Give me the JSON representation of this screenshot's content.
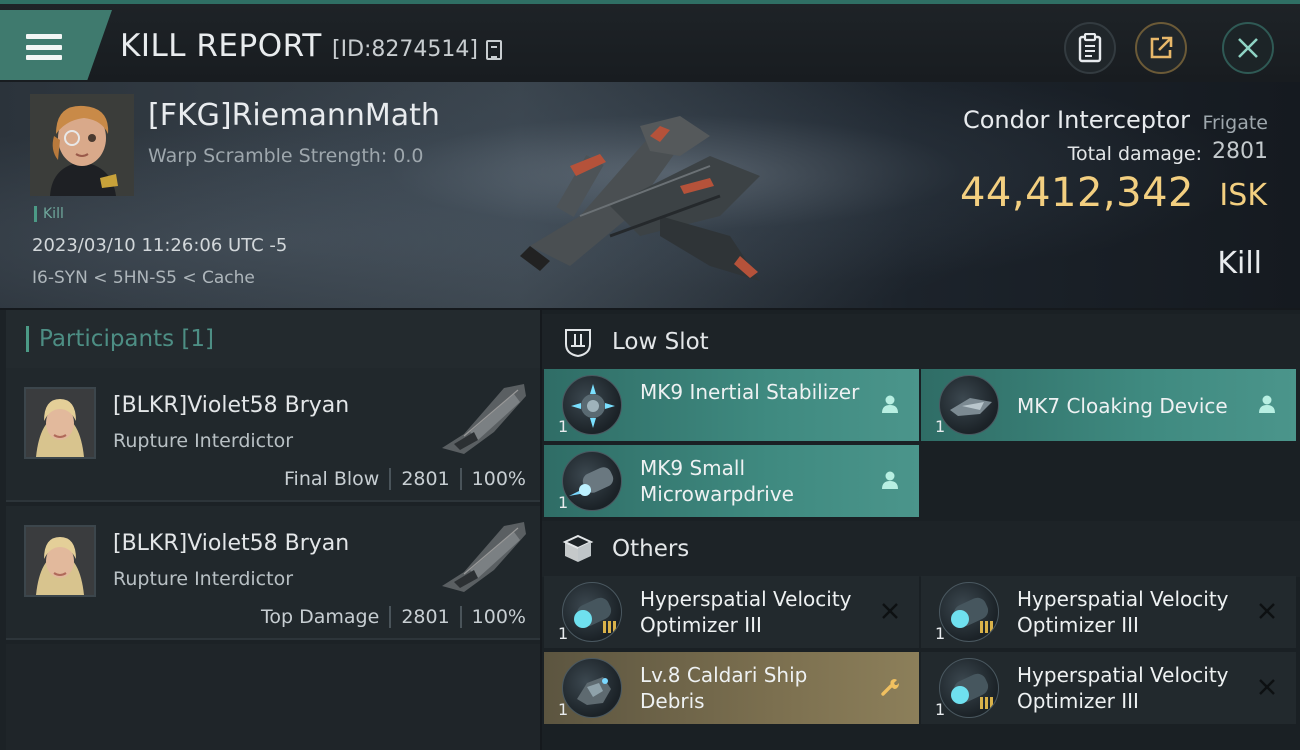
{
  "header": {
    "title": "KILL REPORT",
    "report_id": "[ID:8274514]"
  },
  "victim": {
    "pilot_name": "[FKG]RiemannMath",
    "warp_scramble": "Warp Scramble Strength: 0.0",
    "kill_tag": "Kill",
    "timestamp": "2023/03/10 11:26:06 UTC -5",
    "location": "I6-SYN < 5HN-S5 < Cache",
    "ship_name": "Condor Interceptor",
    "ship_class": "Frigate",
    "total_damage_label": "Total damage:",
    "total_damage": "2801",
    "isk_value": "44,412,342",
    "isk_unit": "ISK",
    "result": "Kill"
  },
  "participants": {
    "title": "Participants",
    "count": "[1]",
    "rows": [
      {
        "name": "[BLKR]Violet58 Bryan",
        "ship": "Rupture Interdictor",
        "role": "Final Blow",
        "damage": "2801",
        "percent": "100%"
      },
      {
        "name": "[BLKR]Violet58 Bryan",
        "ship": "Rupture Interdictor",
        "role": "Top Damage",
        "damage": "2801",
        "percent": "100%"
      }
    ]
  },
  "sections": {
    "low_slot": {
      "label": "Low Slot",
      "items": [
        {
          "name": "MK9 Inertial Stabilizer",
          "qty": "1",
          "status": "dropped",
          "icon": "inertial-stabilizer-icon"
        },
        {
          "name": "MK7 Cloaking Device",
          "qty": "1",
          "status": "dropped",
          "icon": "cloaking-device-icon"
        },
        {
          "name": "MK9 Small Microwarpdrive",
          "qty": "1",
          "status": "dropped",
          "icon": "microwarpdrive-icon"
        }
      ]
    },
    "others": {
      "label": "Others",
      "items": [
        {
          "name": "Hyperspatial Velocity Optimizer III",
          "qty": "1",
          "status": "destroyed",
          "icon": "rig-icon"
        },
        {
          "name": "Hyperspatial Velocity Optimizer III",
          "qty": "1",
          "status": "destroyed",
          "icon": "rig-icon"
        },
        {
          "name": "Lv.8 Caldari Ship Debris",
          "qty": "1",
          "status": "salvage",
          "icon": "debris-icon"
        },
        {
          "name": "Hyperspatial Velocity Optimizer III",
          "qty": "1",
          "status": "destroyed",
          "icon": "rig-icon"
        }
      ]
    }
  },
  "colors": {
    "accent": "#4c9a86",
    "isk_gold": "#f3cf80",
    "dropped_bg": "#3f8a80",
    "salvage_bg": "#7b6f4f",
    "destroyed_bg": "#22292d"
  }
}
